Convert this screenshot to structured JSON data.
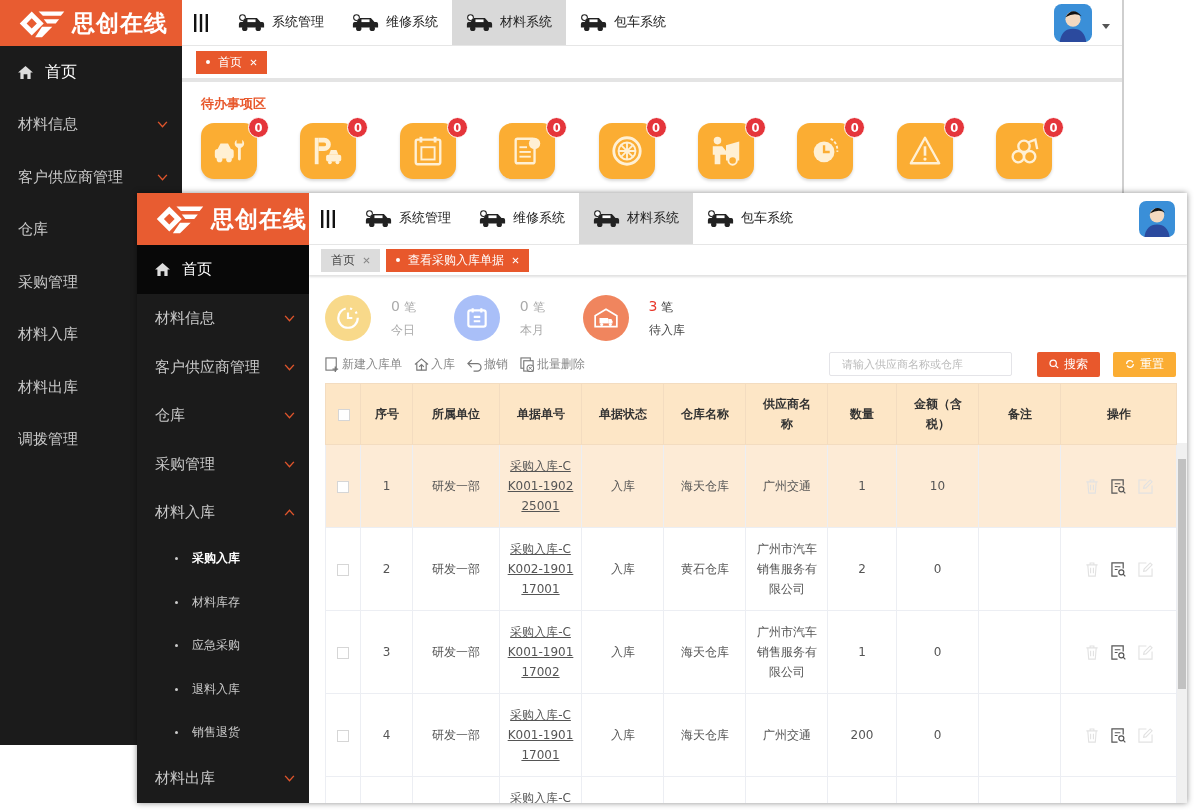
{
  "back_window": {
    "logo": {
      "text": "思创在线"
    },
    "top_nav": [
      {
        "label": "系统管理",
        "selected": false
      },
      {
        "label": "维修系统",
        "selected": false
      },
      {
        "label": "材料系统",
        "selected": true
      },
      {
        "label": "包车系统",
        "selected": false
      }
    ],
    "sidebar": [
      {
        "label": "首页",
        "kind": "home"
      },
      {
        "label": "材料信息",
        "kind": "group"
      },
      {
        "label": "客户供应商管理",
        "kind": "group"
      },
      {
        "label": "仓库",
        "kind": "plain"
      },
      {
        "label": "采购管理",
        "kind": "plain"
      },
      {
        "label": "材料入库",
        "kind": "plain"
      },
      {
        "label": "材料出库",
        "kind": "plain"
      },
      {
        "label": "调拨管理",
        "kind": "plain"
      }
    ],
    "tabs": [
      {
        "label": "首页",
        "selected": true
      }
    ],
    "todo": {
      "title": "待办事项区",
      "items": [
        {
          "count": "0"
        },
        {
          "count": "0"
        },
        {
          "count": "0"
        },
        {
          "count": "0"
        },
        {
          "count": "0"
        },
        {
          "count": "0"
        },
        {
          "count": "0"
        },
        {
          "count": "0"
        },
        {
          "count": "0"
        }
      ]
    }
  },
  "front_window": {
    "logo": {
      "text": "思创在线"
    },
    "top_nav": [
      {
        "label": "系统管理",
        "selected": false
      },
      {
        "label": "维修系统",
        "selected": false
      },
      {
        "label": "材料系统",
        "selected": true
      },
      {
        "label": "包车系统",
        "selected": false
      }
    ],
    "sidebar": [
      {
        "label": "首页",
        "kind": "home",
        "selected": true
      },
      {
        "label": "材料信息",
        "kind": "group",
        "expanded": false,
        "selected": false
      },
      {
        "label": "客户供应商管理",
        "kind": "group",
        "expanded": false,
        "selected": false
      },
      {
        "label": "仓库",
        "kind": "group",
        "expanded": false,
        "selected": false
      },
      {
        "label": "采购管理",
        "kind": "group",
        "expanded": false,
        "selected": false
      },
      {
        "label": "材料入库",
        "kind": "group",
        "expanded": true,
        "selected": false,
        "children": [
          {
            "label": "采购入库",
            "selected": true
          },
          {
            "label": "材料库存",
            "selected": false
          },
          {
            "label": "应急采购",
            "selected": false
          },
          {
            "label": "退料入库",
            "selected": false
          },
          {
            "label": "销售退货",
            "selected": false
          }
        ]
      },
      {
        "label": "材料出库",
        "kind": "group",
        "expanded": false,
        "selected": false
      }
    ],
    "tabs": [
      {
        "label": "首页",
        "selected": false
      },
      {
        "label": "查看采购入库单据",
        "selected": true
      }
    ],
    "stats": [
      {
        "count": "0",
        "unit": "笔",
        "label": "今日",
        "highlight": false
      },
      {
        "count": "0",
        "unit": "笔",
        "label": "本月",
        "highlight": false
      },
      {
        "count": "3",
        "unit": "笔",
        "label": "待入库",
        "highlight": true
      }
    ],
    "toolbar": [
      {
        "label": "新建入库单"
      },
      {
        "label": "入库"
      },
      {
        "label": "撤销"
      },
      {
        "label": "批量删除"
      }
    ],
    "search": {
      "placeholder": "请输入供应商名称或仓库"
    },
    "buttons": [
      {
        "label": "搜索",
        "kind": "primary"
      },
      {
        "label": "重置",
        "kind": "secondary"
      }
    ],
    "table": {
      "all_checked": false,
      "columns": [
        "序号",
        "所属单位",
        "单据单号",
        "单据状态",
        "仓库名称",
        "供应商名称",
        "数量",
        "金额（含税）",
        "备注",
        "操作"
      ],
      "rows": [
        {
          "selected": true,
          "checked": false,
          "no": "1",
          "unit": "研发一部",
          "doc_no": [
            "采购入库-C",
            "K001-1902",
            "25001"
          ],
          "status": "入库",
          "warehouse": "海天仓库",
          "supplier": "广州交通",
          "qty": "1",
          "amount": "10"
        },
        {
          "selected": false,
          "checked": false,
          "no": "2",
          "unit": "研发一部",
          "doc_no": [
            "采购入库-C",
            "K002-1901",
            "17001"
          ],
          "status": "入库",
          "warehouse": "黄石仓库",
          "supplier": "广州市汽车销售服务有限公司",
          "qty": "2",
          "amount": "0"
        },
        {
          "selected": false,
          "checked": false,
          "no": "3",
          "unit": "研发一部",
          "doc_no": [
            "采购入库-C",
            "K001-1901",
            "17002"
          ],
          "status": "入库",
          "warehouse": "海天仓库",
          "supplier": "广州市汽车销售服务有限公司",
          "qty": "1",
          "amount": "0"
        },
        {
          "selected": false,
          "checked": false,
          "no": "4",
          "unit": "研发一部",
          "doc_no": [
            "采购入库-C",
            "K001-1901",
            "17001"
          ],
          "status": "入库",
          "warehouse": "海天仓库",
          "supplier": "广州交通",
          "qty": "200",
          "amount": "0"
        },
        {
          "selected": false,
          "doc_no": [
            "采购入库-C"
          ]
        }
      ]
    }
  }
}
